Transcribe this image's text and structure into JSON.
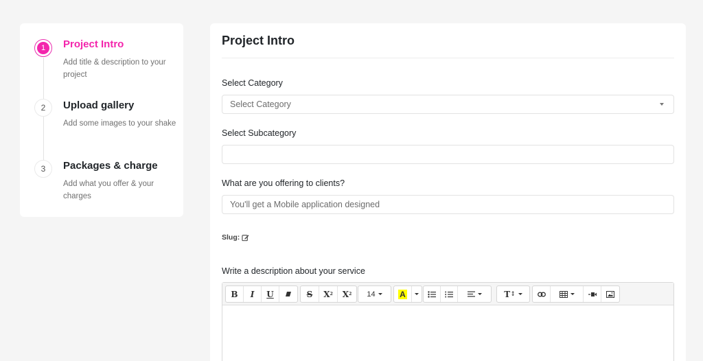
{
  "steps": [
    {
      "number": "1",
      "title": "Project Intro",
      "description": "Add title & description to your project"
    },
    {
      "number": "2",
      "title": "Upload gallery",
      "description": "Add some images to your shake"
    },
    {
      "number": "3",
      "title": "Packages & charge",
      "description": "Add what you offer & your charges"
    }
  ],
  "form": {
    "title": "Project Intro",
    "category_label": "Select Category",
    "category_value": "Select Category",
    "subcategory_label": "Select Subcategory",
    "subcategory_value": "",
    "offering_label": "What are you offering to clients?",
    "offering_placeholder": "You'll get a Mobile application designed",
    "slug_label": "Slug:",
    "description_label": "Write a description about your service"
  },
  "editor": {
    "bold": "B",
    "italic": "I",
    "underline": "U",
    "strike": "S",
    "superscript": "X",
    "sup_mark": "2",
    "subscript": "X",
    "sub_mark": "2",
    "font_size": "14",
    "highlight": "A",
    "line_height": "T",
    "line_height_arrows": "↕"
  },
  "colors": {
    "accent": "#f325ac",
    "highlight": "#ffff00"
  }
}
